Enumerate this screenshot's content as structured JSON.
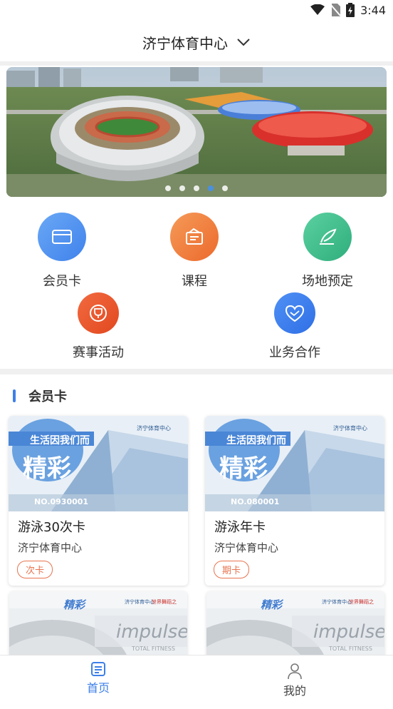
{
  "status": {
    "time": "3:44"
  },
  "header": {
    "title": "济宁体育中心"
  },
  "banner": {
    "dots": 5,
    "active_dot": 3
  },
  "nav": {
    "member_card": "会员卡",
    "course": "课程",
    "venue_booking": "场地预定",
    "events": "赛事活动",
    "business": "业务合作"
  },
  "section": {
    "title": "会员卡"
  },
  "cards": [
    {
      "name": "游泳30次卡",
      "venue": "济宁体育中心",
      "tag": "次卡",
      "image_slogan": "生活因我们而",
      "image_big": "精彩",
      "image_no": "NO.0930001",
      "image_logo": "济宁体育中心"
    },
    {
      "name": "游泳年卡",
      "venue": "济宁体育中心",
      "tag": "期卡",
      "image_slogan": "生活因我们而",
      "image_big": "精彩",
      "image_no": "NO.080001",
      "image_logo": "济宁体育中心"
    }
  ],
  "cards_row2": [
    {
      "image_big": "精彩",
      "image_logo": "济宁体育中心",
      "image_logo2": "世界舞蹈之",
      "image_brand": "impulse",
      "image_sub": "TOTAL FITNESS"
    },
    {
      "image_big": "精彩",
      "image_logo": "济宁体育中心",
      "image_logo2": "世界舞蹈之",
      "image_brand": "impulse",
      "image_sub": "TOTAL FITNESS"
    }
  ],
  "tabbar": {
    "home": "首页",
    "mine": "我的"
  },
  "colors": {
    "accent": "#3d7fe8",
    "tag": "#e8734f",
    "blue_icon": "#4a8ef0",
    "orange_icon": "#f07a3c",
    "green_icon": "#3dba8a",
    "red_icon": "#ee5630",
    "blue2_icon": "#3a7ff0"
  }
}
